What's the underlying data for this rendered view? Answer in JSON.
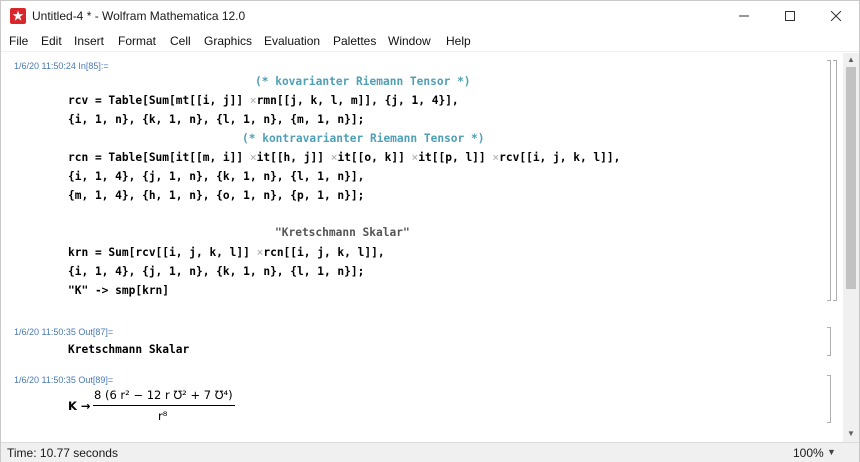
{
  "window": {
    "title": "Untitled-4 * - Wolfram Mathematica 12.0",
    "icon": "mathematica-icon",
    "controls": [
      "minimize",
      "maximize",
      "close"
    ]
  },
  "menu": [
    "File",
    "Edit",
    "Insert",
    "Format",
    "Cell",
    "Graphics",
    "Evaluation",
    "Palettes",
    "Window",
    "Help"
  ],
  "input_cell": {
    "label": "1/6/20 11:50:24 In[85]:=",
    "comment1": "(* kovarianter Riemann Tensor *)",
    "rcv_line1_a": "rcv = Table[Sum[mt[[i, j]] ",
    "rcv_line1_b": "rmn[[j, k, l, m]], {j, 1, 4}],",
    "rcv_line2": "{i, 1, n}, {k, 1, n}, {l, 1, n}, {m, 1, n}];",
    "comment2": "(* kontravarianter Riemann Tensor *)",
    "rcn_line1_a": "rcn = Table[Sum[it[[m, i]] ",
    "rcn_line1_b": "it[[h, j]] ",
    "rcn_line1_c": "it[[o, k]] ",
    "rcn_line1_d": "it[[p, l]] ",
    "rcn_line1_e": "rcv[[i, j, k, l]],",
    "rcn_line2": "{i, 1, 4}, {j, 1, n}, {k, 1, n}, {l, 1, n}],",
    "rcn_line3": "{m, 1, 4}, {h, 1, n}, {o, 1, n}, {p, 1, n}];",
    "string_line": "\"Kretschmann Skalar\"",
    "krn_line1_a": "krn = Sum[rcv[[i, j, k, l]] ",
    "krn_line1_b": "rcn[[i, j, k, l]],",
    "krn_line2": "{i, 1, 4}, {j, 1, n}, {k, 1, n}, {l, 1, n}];",
    "k_line": "\"K\" -> smp[krn]",
    "times_symbol": "×"
  },
  "output_cell_1": {
    "label": "1/6/20 11:50:35 Out[87]=",
    "text": "Kretschmann Skalar"
  },
  "output_cell_2": {
    "label": "1/6/20 11:50:35 Out[89]=",
    "lhs": "K →",
    "numerator": "8 (6 r² − 12 r ℧² + 7 ℧⁴)",
    "denominator": "r⁸"
  },
  "status": {
    "time": "Time: 10.77 seconds",
    "zoom": "100%"
  }
}
